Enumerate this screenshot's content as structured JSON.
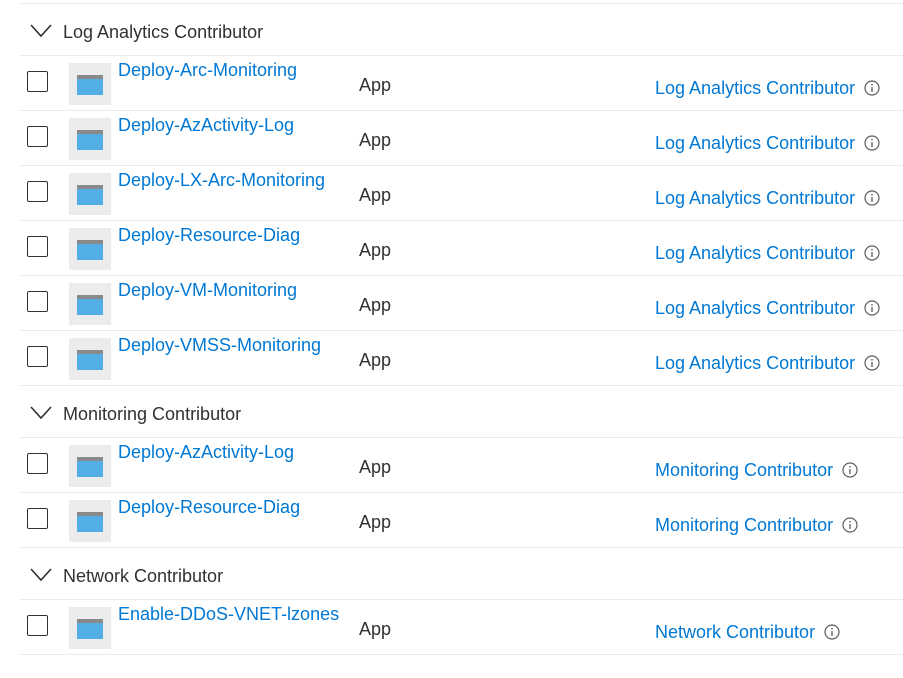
{
  "groups": [
    {
      "title": "Log Analytics Contributor",
      "rows": [
        {
          "name": "Deploy-Arc-Monitoring",
          "type": "App",
          "role": "Log Analytics Contributor"
        },
        {
          "name": "Deploy-AzActivity-Log",
          "type": "App",
          "role": "Log Analytics Contributor"
        },
        {
          "name": "Deploy-LX-Arc-Monitoring",
          "type": "App",
          "role": "Log Analytics Contributor"
        },
        {
          "name": "Deploy-Resource-Diag",
          "type": "App",
          "role": "Log Analytics Contributor"
        },
        {
          "name": "Deploy-VM-Monitoring",
          "type": "App",
          "role": "Log Analytics Contributor"
        },
        {
          "name": "Deploy-VMSS-Monitoring",
          "type": "App",
          "role": "Log Analytics Contributor"
        }
      ]
    },
    {
      "title": "Monitoring Contributor",
      "rows": [
        {
          "name": "Deploy-AzActivity-Log",
          "type": "App",
          "role": "Monitoring Contributor"
        },
        {
          "name": "Deploy-Resource-Diag",
          "type": "App",
          "role": "Monitoring Contributor"
        }
      ]
    },
    {
      "title": "Network Contributor",
      "rows": [
        {
          "name": "Enable-DDoS-VNET-lzones",
          "type": "App",
          "role": "Network Contributor"
        }
      ]
    }
  ],
  "icons": {
    "group_toggle": "chevron-down-icon",
    "row_select": "checkbox-icon",
    "app": "app-window-icon",
    "role_info": "info-icon"
  },
  "colors": {
    "link": "#0078d4",
    "text": "#323130",
    "divider": "#edebe9",
    "icon_bg": "#ececec"
  }
}
